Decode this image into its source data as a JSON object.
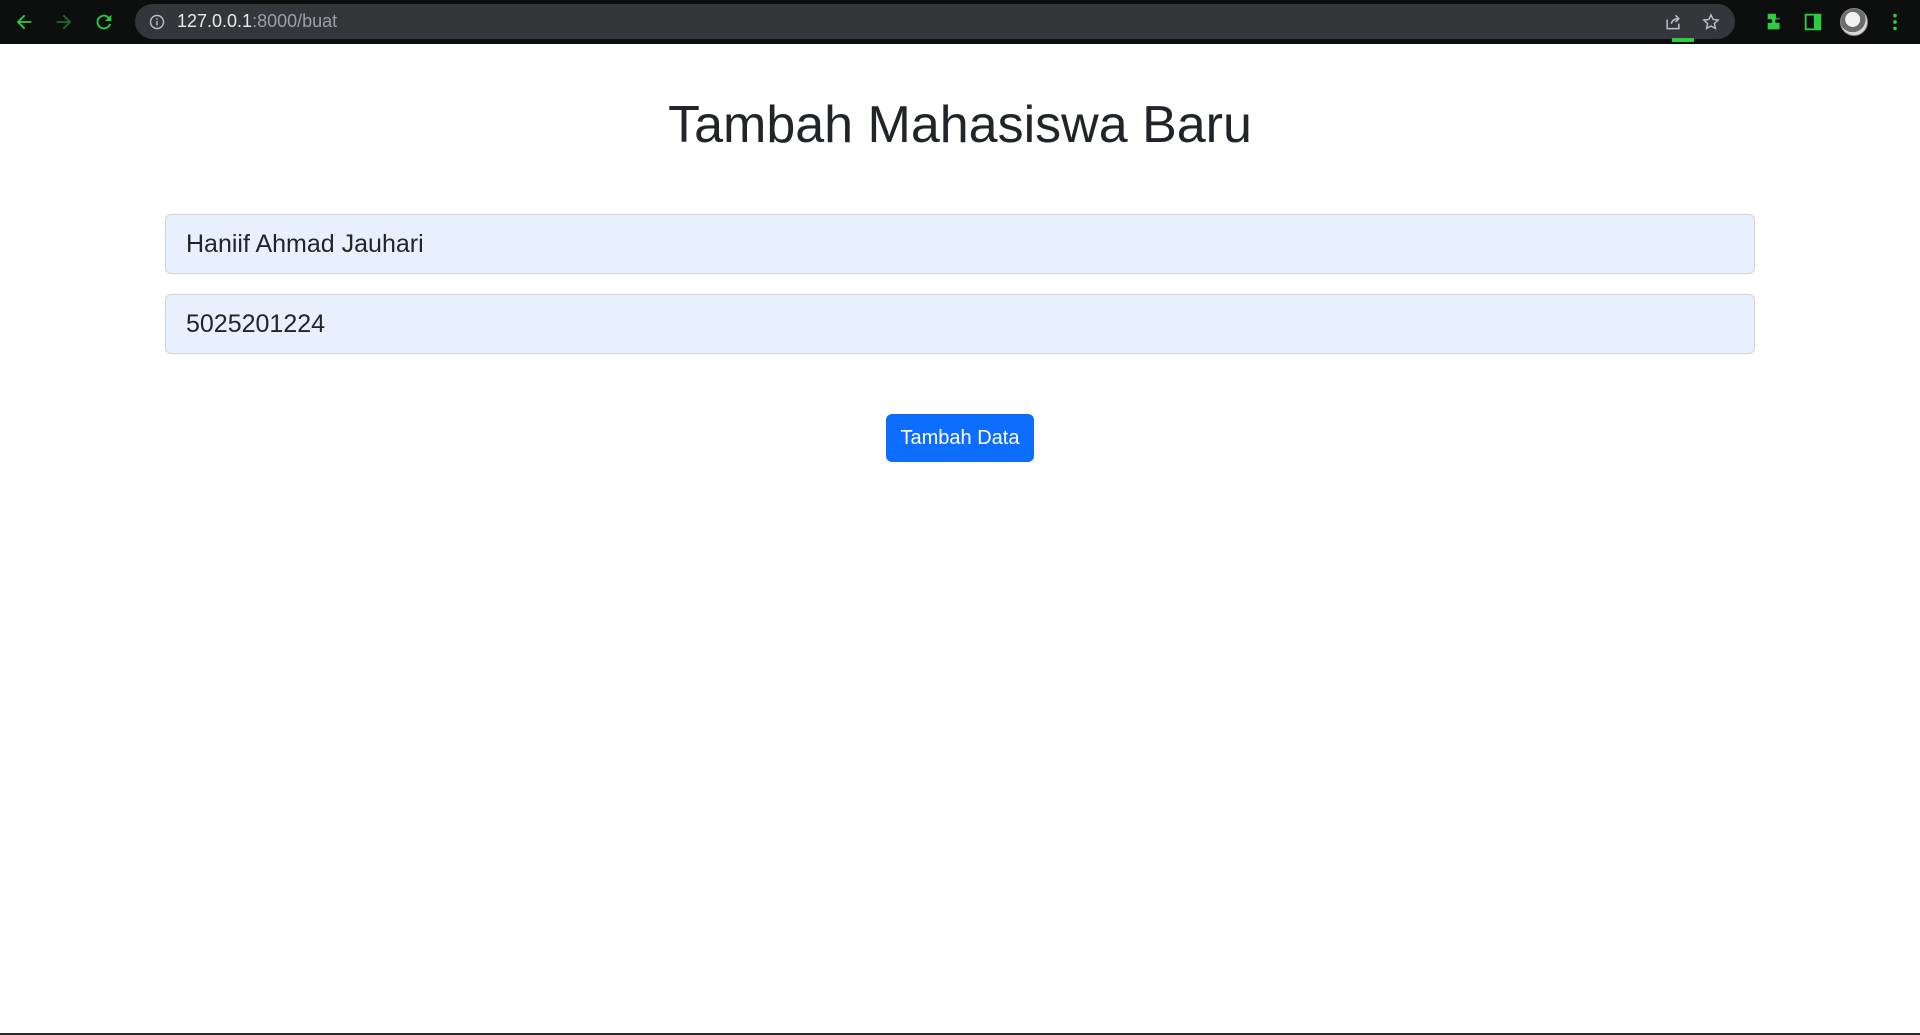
{
  "browser": {
    "url_host": "127.0.0.1",
    "url_path": ":8000/buat",
    "icons": [
      "back-icon",
      "forward-icon",
      "reload-icon",
      "info-icon",
      "share-icon",
      "star-icon",
      "extensions-icon",
      "side-panel-icon",
      "profile-avatar",
      "menu-icon"
    ]
  },
  "form": {
    "title": "Tambah Mahasiswa Baru",
    "nama_value": "Haniif Ahmad Jauhari",
    "nrp_value": "5025201224",
    "submit_label": "Tambah Data"
  },
  "colors": {
    "accent": "#0d6efd",
    "field_bg": "#e8effd",
    "text": "#212529",
    "chrome_bg": "#0d0f0e"
  }
}
